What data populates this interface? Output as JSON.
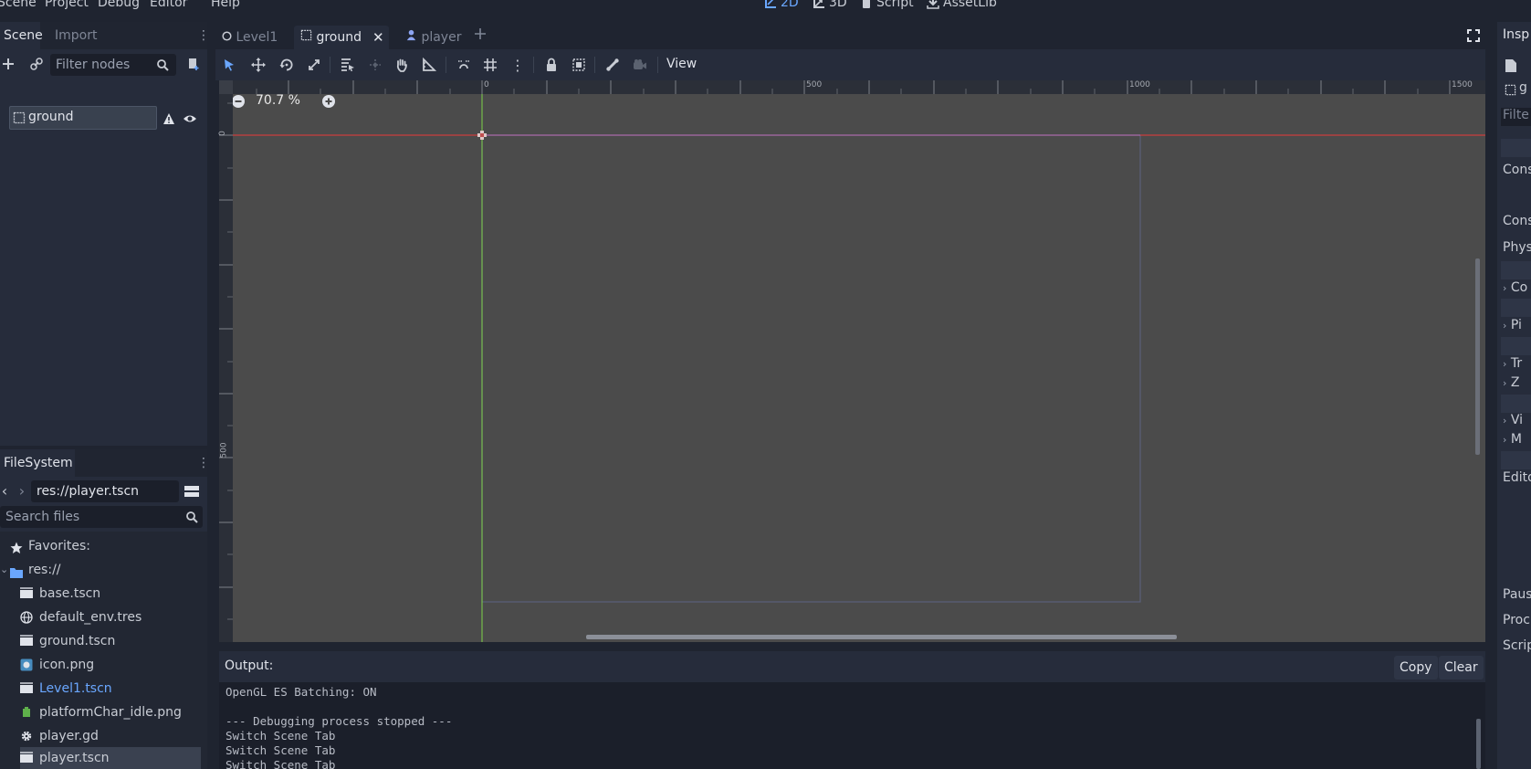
{
  "menu": {
    "items": [
      "Scene",
      "Project",
      "Debug",
      "Editor",
      "Help"
    ]
  },
  "workspaces": {
    "active_color": "#6aa7ff",
    "items": [
      {
        "label": "2D",
        "icon": "2d-workspace-icon",
        "active": true
      },
      {
        "label": "3D",
        "icon": "3d-workspace-icon",
        "active": false
      },
      {
        "label": "Script",
        "icon": "script-workspace-icon",
        "active": false
      },
      {
        "label": "AssetLib",
        "icon": "assetlib-workspace-icon",
        "active": false
      }
    ]
  },
  "scene_dock": {
    "tabs": [
      "Scene",
      "Import"
    ],
    "filter_placeholder": "Filter nodes",
    "tree": [
      {
        "label": "ground",
        "selected": true,
        "icon": "node2d-icon",
        "warning": true,
        "visible": true
      }
    ]
  },
  "filesystem": {
    "tab": "FileSystem",
    "path": "res://player.tscn",
    "search_placeholder": "Search files",
    "favorites_label": "Favorites:",
    "root_label": "res://",
    "files": [
      {
        "label": "base.tscn",
        "icon": "scene-file-icon"
      },
      {
        "label": "default_env.tres",
        "icon": "environment-icon"
      },
      {
        "label": "ground.tscn",
        "icon": "scene-file-icon"
      },
      {
        "label": "icon.png",
        "icon": "image-icon"
      },
      {
        "label": "Level1.tscn",
        "icon": "scene-file-icon",
        "highlight": true
      },
      {
        "label": "platformChar_idle.png",
        "icon": "image-icon"
      },
      {
        "label": "player.gd",
        "icon": "gear-icon"
      },
      {
        "label": "player.tscn",
        "icon": "scene-file-icon",
        "selected": true
      }
    ]
  },
  "scene_tabs": [
    {
      "label": "Level1",
      "icon": "circle-icon",
      "active": false
    },
    {
      "label": "ground",
      "icon": "node2d-icon",
      "active": true,
      "closable": true
    },
    {
      "label": "player",
      "icon": "player-icon",
      "active": false
    }
  ],
  "canvas": {
    "zoom": "70.7 %",
    "view_menu": "View",
    "ruler_top": [
      "0",
      "500",
      "1000",
      "1500"
    ],
    "ruler_left": [
      "0",
      "500"
    ]
  },
  "output": {
    "title": "Output:",
    "copy_label": "Copy",
    "clear_label": "Clear",
    "lines": [
      "OpenGL ES Batching: ON",
      "",
      "--- Debugging process stopped ---",
      "Switch Scene Tab",
      "Switch Scene Tab",
      "Switch Scene Tab"
    ]
  },
  "inspector": {
    "tab": "Insp",
    "node_label": "g",
    "filter": "Filte",
    "rows": [
      "Cons",
      "Cons",
      "Phys",
      "Co",
      "Pi",
      "Tr",
      "Z",
      "Vi",
      "M",
      "Edito",
      "Paus",
      "Proc",
      "Scrip"
    ]
  }
}
